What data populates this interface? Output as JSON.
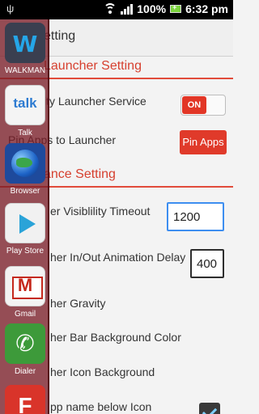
{
  "status_bar": {
    "usb_icon": "usb-icon",
    "battery_percent": "100%",
    "time": "6:32 pm"
  },
  "header": {
    "title": "nity Setting"
  },
  "sections": {
    "launcher": "Launcher Setting",
    "appearance": "ance Setting"
  },
  "settings": {
    "service_label": "ity Launcher Service",
    "service_toggle": "ON",
    "pin_label": "Pin Apps to Launcher",
    "pin_button": "Pin Apps",
    "visibility_label": "er Visiblility Timeout",
    "visibility_value": "1200",
    "animation_label": "her In/Out Animation Delay",
    "animation_value": "400",
    "gravity_label": "her Gravity",
    "bar_color_label": "her Bar Background Color",
    "icon_bg_label": "her Icon Background",
    "app_name_label": "pp name below Icon"
  },
  "sidebar_apps": [
    {
      "name": "WALKMAN",
      "icon": "walkman-icon"
    },
    {
      "name": "Talk",
      "icon": "talk-icon"
    },
    {
      "name": "Browser",
      "icon": "browser-icon"
    },
    {
      "name": "Play Store",
      "icon": "play-store-icon"
    },
    {
      "name": "Gmail",
      "icon": "gmail-icon"
    },
    {
      "name": "Dialer",
      "icon": "dialer-icon"
    },
    {
      "name": "",
      "icon": "flipboard-icon"
    }
  ],
  "colors": {
    "accent": "#e03a2a",
    "sidebar": "#7a1e28",
    "focus": "#3d8ef0"
  }
}
